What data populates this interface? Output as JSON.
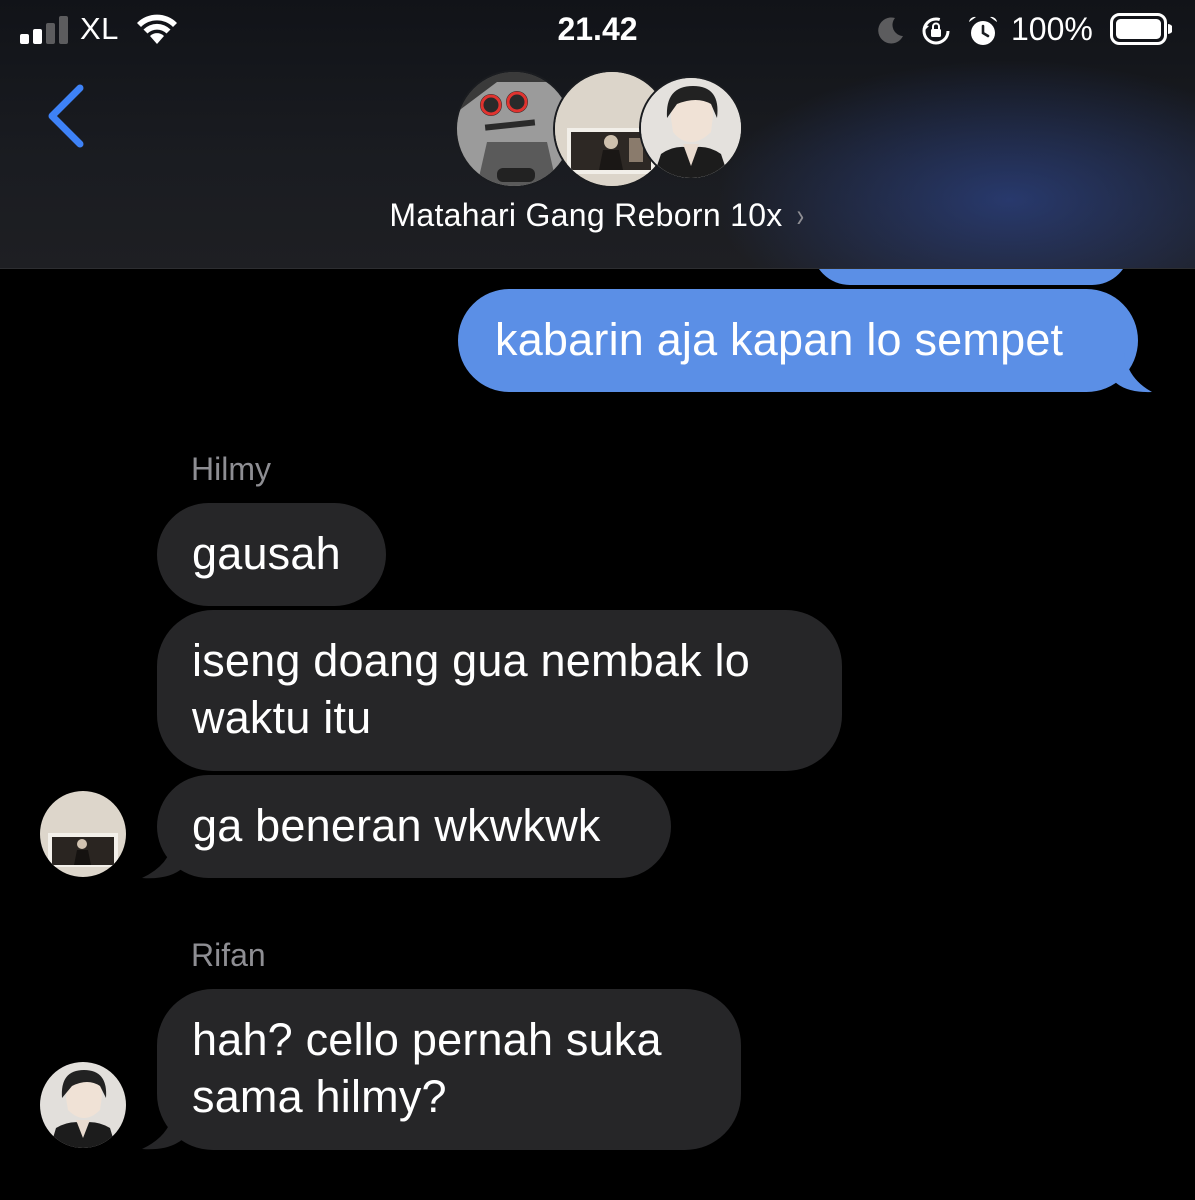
{
  "status_bar": {
    "carrier": "XL",
    "time": "21.42",
    "battery_percent": "100%",
    "icons": [
      "signal-icon",
      "wifi-icon",
      "moon-icon",
      "rotation-lock-icon",
      "alarm-icon",
      "battery-icon"
    ]
  },
  "header": {
    "back_icon": "chevron-left-icon",
    "group_name": "Matahari Gang Reborn 10x",
    "chevron": "›",
    "accent_color": "#3e82f7"
  },
  "messages": [
    {
      "direction": "outgoing",
      "text": ""
    },
    {
      "direction": "outgoing",
      "text": "kabarin aja kapan lo sempet"
    },
    {
      "sender": "Hilmy",
      "direction": "incoming",
      "text": "gausah"
    },
    {
      "sender": "Hilmy",
      "direction": "incoming",
      "lines": [
        "iseng doang gua nembak lo",
        "waktu itu"
      ]
    },
    {
      "sender": "Hilmy",
      "direction": "incoming",
      "text": "ga beneran wkwkwk"
    },
    {
      "sender": "Rifan",
      "direction": "incoming",
      "lines": [
        "hah? cello pernah suka",
        "sama hilmy?"
      ]
    }
  ],
  "colors": {
    "outgoing_bubble": "#5b8fe6",
    "incoming_bubble": "#262628",
    "sender_label": "#8e8e93",
    "background": "#000000"
  }
}
